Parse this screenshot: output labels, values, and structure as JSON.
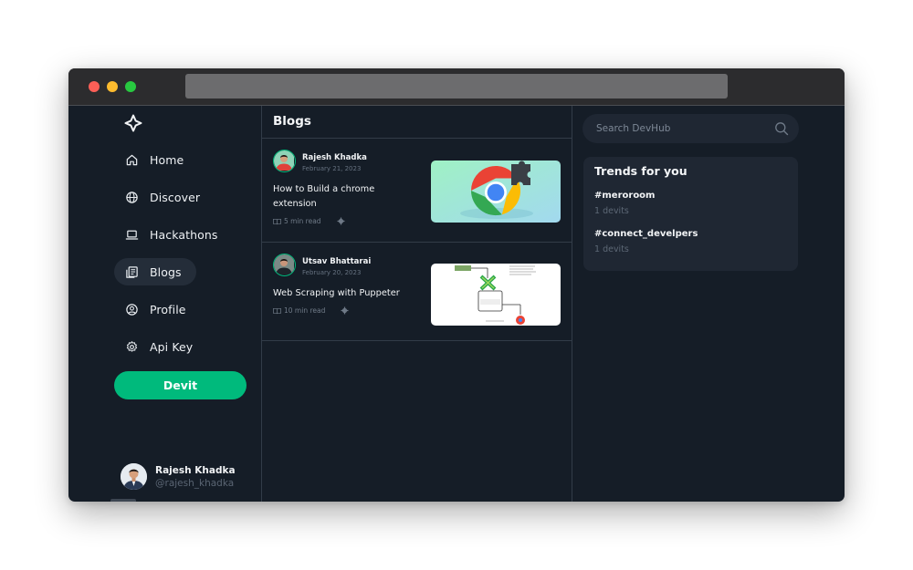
{
  "sidebar": {
    "nav": [
      {
        "label": "Home",
        "icon": "home-icon"
      },
      {
        "label": "Discover",
        "icon": "globe-icon"
      },
      {
        "label": "Hackathons",
        "icon": "laptop-icon"
      },
      {
        "label": "Blogs",
        "icon": "blog-icon",
        "active": true
      },
      {
        "label": "Profile",
        "icon": "user-circle-icon"
      },
      {
        "label": "Api Key",
        "icon": "gear-icon"
      }
    ],
    "devit_label": "Devit",
    "profile": {
      "name": "Rajesh Khadka",
      "handle": "@rajesh_khadka"
    }
  },
  "main": {
    "title": "Blogs",
    "posts": [
      {
        "author": "Rajesh Khadka",
        "date": "February 21, 2023",
        "title": "How to Build a chrome extension",
        "read_time": "5 min read",
        "thumbnail": "chrome-extension-logo"
      },
      {
        "author": "Utsav Bhattarai",
        "date": "February 20, 2023",
        "title": "Web Scraping with Puppeter",
        "read_time": "10 min read",
        "thumbnail": "node-puppeteer-diagram"
      }
    ]
  },
  "right": {
    "search_placeholder": "Search DevHub",
    "trends_title": "Trends for you",
    "trends": [
      {
        "tag": "#meroroom",
        "count": "1 devits"
      },
      {
        "tag": "#connect_develpers",
        "count": "1 devits"
      }
    ]
  },
  "colors": {
    "background": "#151d27",
    "accent": "#00ba7c",
    "panel": "#1f2733",
    "divider": "#323c48"
  }
}
